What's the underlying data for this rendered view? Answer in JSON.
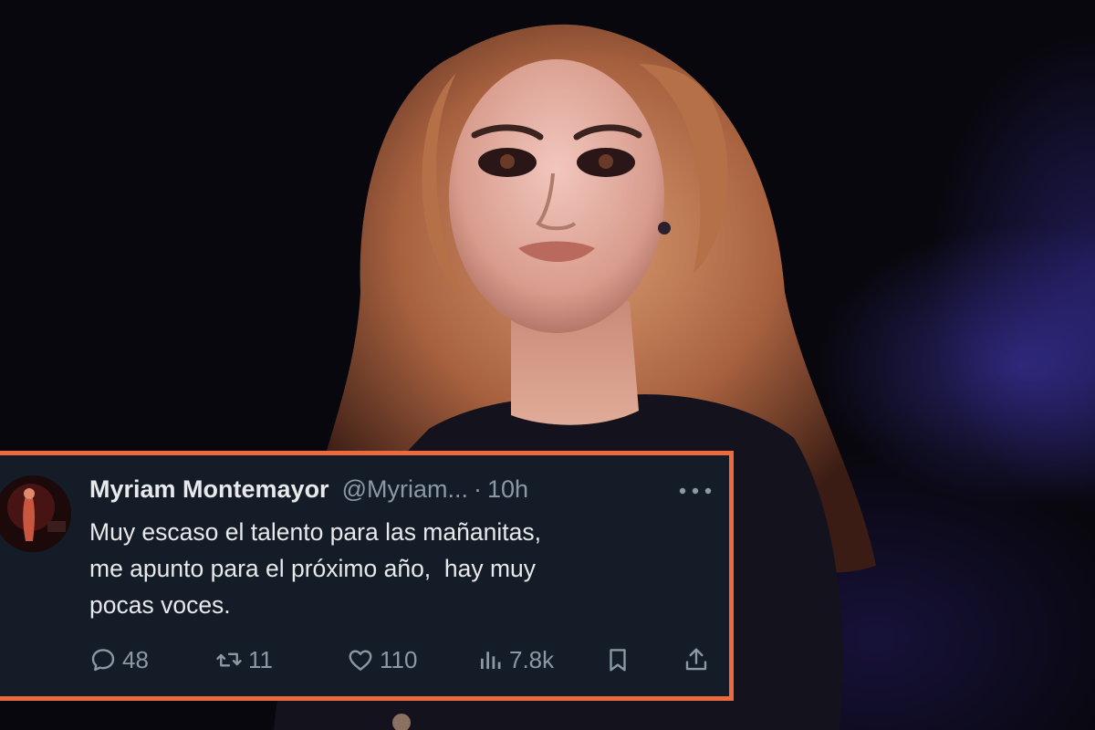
{
  "tweet": {
    "author_name": "Myriam Montemayor",
    "author_handle": "@Myriam...",
    "separator": "·",
    "time": "10h",
    "text_lines": [
      "Muy escaso el talento para las mañanitas,",
      "me apunto para el próximo año,  hay muy",
      "pocas voces."
    ],
    "actions": {
      "replies": "48",
      "retweets": "11",
      "likes": "110",
      "views": "7.8k"
    }
  },
  "colors": {
    "card_border": "#ec6a3e",
    "card_background": "#141c28",
    "text_primary": "#e7e9ea",
    "text_secondary": "#8b98a5"
  },
  "icons": [
    "more-icon",
    "reply-icon",
    "retweet-icon",
    "like-icon",
    "views-icon",
    "bookmark-icon",
    "share-icon"
  ]
}
